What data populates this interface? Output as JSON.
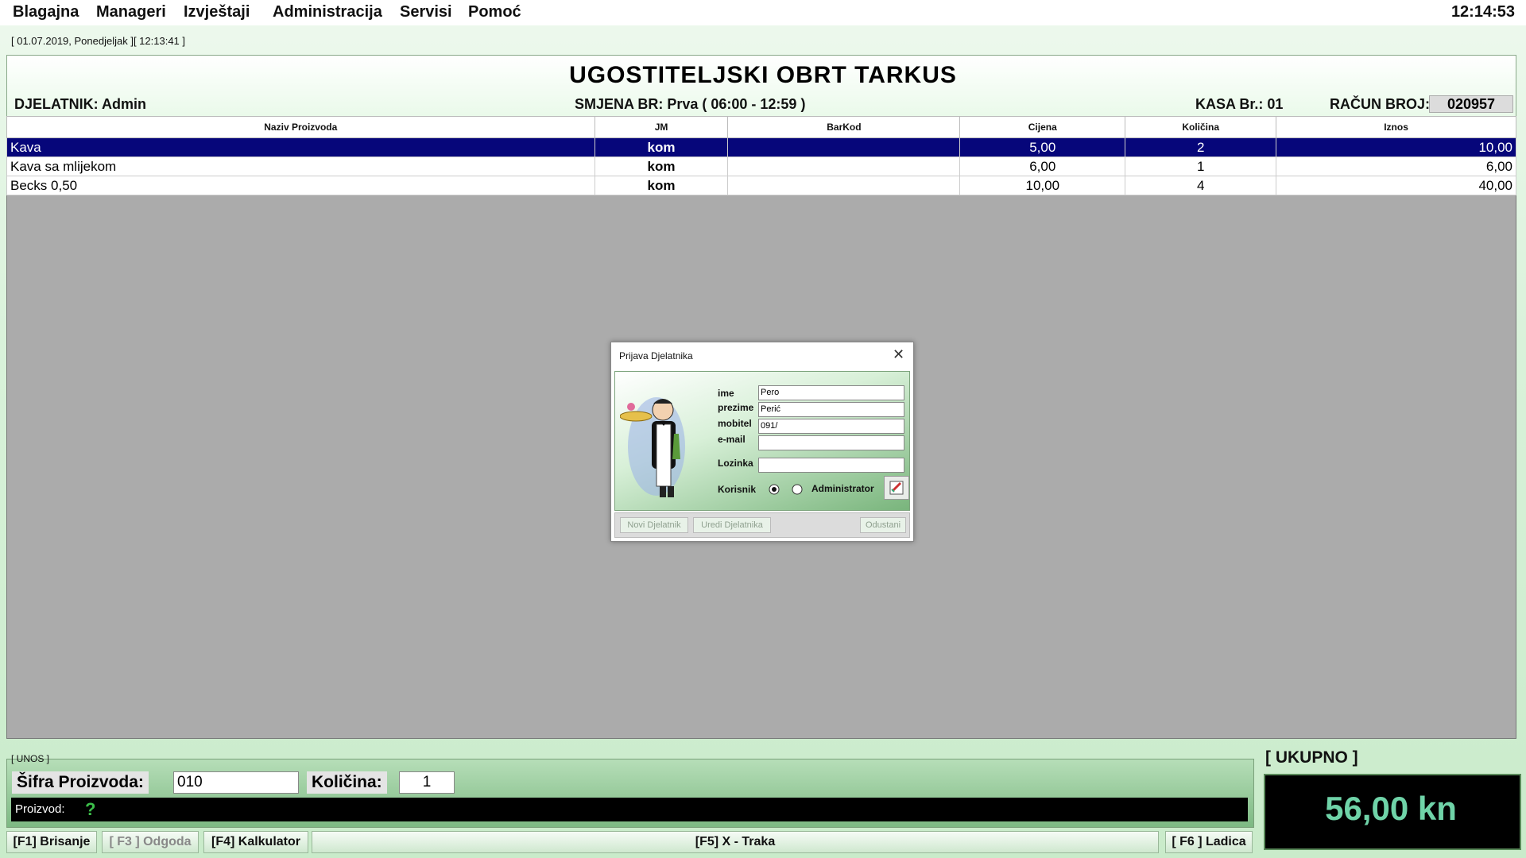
{
  "menu": [
    "Blagajna",
    "Manageri",
    "Izvještaji",
    "Administracija",
    "Servisi",
    "Pomoć"
  ],
  "clock": "12:14:53",
  "session_date": "[ 01.07.2019, Ponedjeljak ][ 12:13:41 ]",
  "header": {
    "company": "UGOSTITELJSKI OBRT TARKUS",
    "djelatnik": "DJELATNIK: Admin",
    "smjena": "SMJENA BR:  Prva ( 06:00 - 12:59 )",
    "kasa": "KASA Br.:  01",
    "racun_label": "RAČUN BROJ:",
    "racun_value": "020957"
  },
  "table": {
    "columns": [
      "Naziv Proizvoda",
      "JM",
      "BarKod",
      "Cijena",
      "Količina",
      "Iznos"
    ],
    "rows": [
      {
        "name": "Kava",
        "jm": "kom",
        "barkod": "",
        "cijena": "5,00",
        "kolicina": "2",
        "iznos": "10,00"
      },
      {
        "name": "Kava sa mlijekom",
        "jm": "kom",
        "barkod": "",
        "cijena": "6,00",
        "kolicina": "1",
        "iznos": "6,00"
      },
      {
        "name": "Becks 0,50",
        "jm": "kom",
        "barkod": "",
        "cijena": "10,00",
        "kolicina": "4",
        "iznos": "40,00"
      }
    ]
  },
  "dialog": {
    "title": "Prijava Djelatnika",
    "labels": {
      "ime": "ime",
      "prezime": "prezime",
      "mobitel": "mobitel",
      "email": "e-mail",
      "lozinka": "Lozinka",
      "korisnik": "Korisnik",
      "administrator": "Administrator"
    },
    "values": {
      "ime": "Pero",
      "prezime": "Perić",
      "mobitel": "091/",
      "email": "",
      "lozinka": ""
    },
    "role_selected": "Korisnik",
    "buttons": {
      "novi": "Novi Djelatnik",
      "uredi": "Uredi Djelatnika",
      "odustani": "Odustani"
    }
  },
  "entry": {
    "section": "[ UNOS ]",
    "sifra_label": "Šifra Proizvoda:",
    "sifra_value": "010",
    "kolicina_label": "Količina:",
    "kolicina_value": "1",
    "proizvod_label": "Proizvod:"
  },
  "function_keys": {
    "f1": "[F1] Brisanje",
    "f3": "[ F3 ] Odgoda",
    "f4": "[F4] Kalkulator",
    "f5": "[F5]    X - Traka",
    "f6": "[ F6 ] Ladica"
  },
  "total": {
    "label": "[ UKUPNO ]",
    "value": "56,00 kn"
  },
  "colors": {
    "selected_row": "#06067a",
    "total_text": "#6fd3a8",
    "accent_green": "#7db983"
  }
}
